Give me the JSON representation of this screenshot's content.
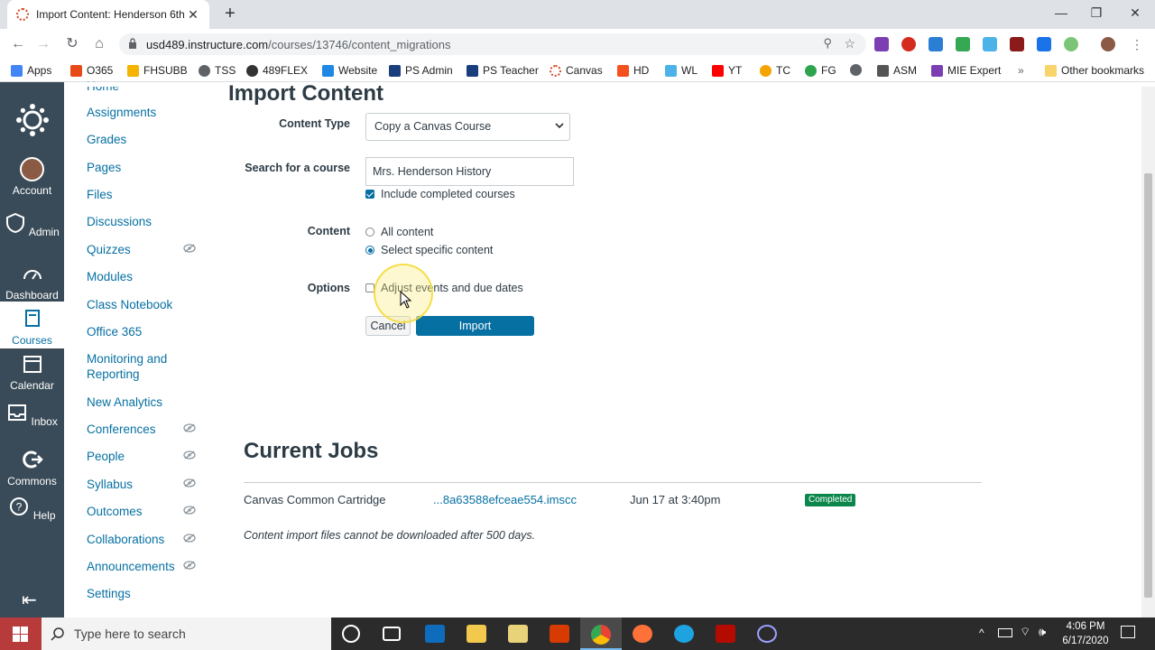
{
  "browser": {
    "tab_title": "Import Content: Henderson 6th",
    "url_host": "usd489.instructure.com",
    "url_path": "/courses/13746/content_migrations",
    "bookmarks": [
      "Apps",
      "O365",
      "FHSUBB",
      "TSS",
      "489FLEX",
      "Website",
      "PS Admin",
      "PS Teacher",
      "Canvas",
      "HD",
      "WL",
      "YT",
      "TC",
      "FG",
      "ASM",
      "MIE Expert",
      "Other bookmarks"
    ]
  },
  "global_nav": {
    "items": [
      "Account",
      "Admin",
      "Dashboard",
      "Courses",
      "Calendar",
      "Inbox",
      "Commons",
      "Help"
    ]
  },
  "course_nav": {
    "items": [
      {
        "label": "Home",
        "hidden": false
      },
      {
        "label": "Assignments",
        "hidden": false
      },
      {
        "label": "Grades",
        "hidden": false
      },
      {
        "label": "Pages",
        "hidden": false
      },
      {
        "label": "Files",
        "hidden": false
      },
      {
        "label": "Discussions",
        "hidden": false
      },
      {
        "label": "Quizzes",
        "hidden": true
      },
      {
        "label": "Modules",
        "hidden": false
      },
      {
        "label": "Class Notebook",
        "hidden": false
      },
      {
        "label": "Office 365",
        "hidden": false
      },
      {
        "label": "Monitoring and",
        "hidden": false
      },
      {
        "label": "Reporting",
        "hidden": false
      },
      {
        "label": "New Analytics",
        "hidden": false
      },
      {
        "label": "Conferences",
        "hidden": true
      },
      {
        "label": "People",
        "hidden": true
      },
      {
        "label": "Syllabus",
        "hidden": true
      },
      {
        "label": "Outcomes",
        "hidden": true
      },
      {
        "label": "Collaborations",
        "hidden": true
      },
      {
        "label": "Announcements",
        "hidden": true
      },
      {
        "label": "Settings",
        "hidden": false
      }
    ]
  },
  "main": {
    "title": "Import Content",
    "content_type_label": "Content Type",
    "content_type_value": "Copy a Canvas Course",
    "search_label": "Search for a course",
    "search_value": "Mrs. Henderson History",
    "include_completed_label": "Include completed courses",
    "include_completed_checked": true,
    "content_label": "Content",
    "content_options": [
      "All content",
      "Select specific content"
    ],
    "content_selected": "Select specific content",
    "options_label": "Options",
    "adjust_dates_label": "Adjust events and due dates",
    "adjust_dates_checked": false,
    "cancel_label": "Cancel",
    "import_label": "Import"
  },
  "jobs": {
    "title": "Current Jobs",
    "rows": [
      {
        "type": "Canvas Common Cartridge",
        "file": "...8a63588efceae554.imscc",
        "date": "Jun 17 at 3:40pm",
        "status": "Completed"
      }
    ],
    "note": "Content import files cannot be downloaded after 500 days."
  },
  "taskbar": {
    "search_placeholder": "Type here to search",
    "time": "4:06 PM",
    "date": "6/17/2020"
  },
  "colors": {
    "canvas_nav": "#394b58",
    "link": "#0770a3",
    "button_primary": "#0770a3",
    "badge_completed": "#0b874b"
  }
}
